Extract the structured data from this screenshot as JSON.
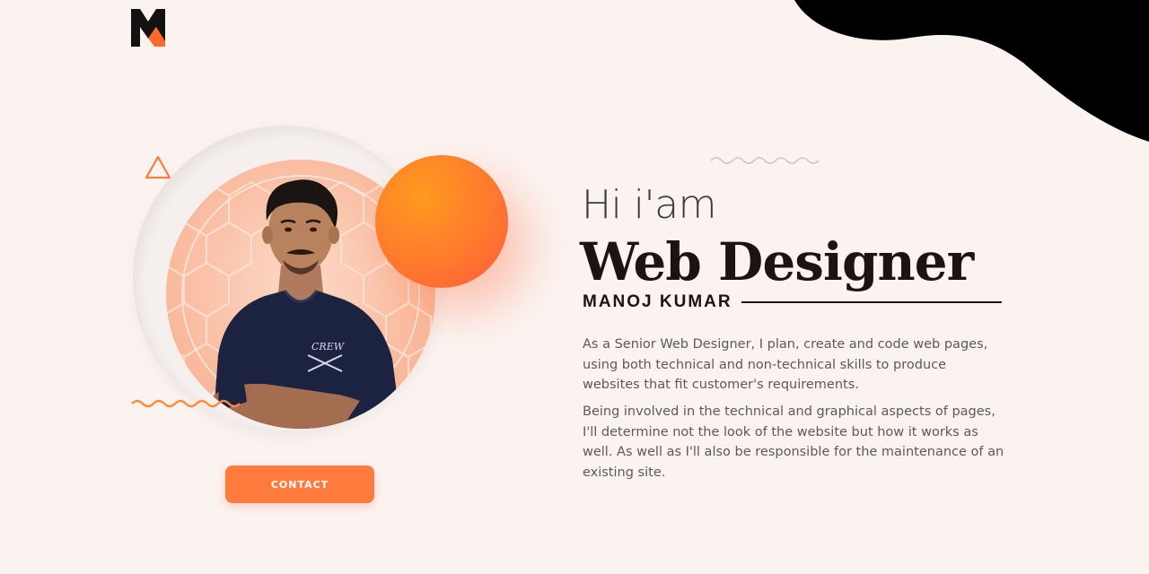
{
  "brand": {
    "logo_icon": "m-monogram-logo-icon",
    "colors": {
      "accent": "#ff7a3d",
      "dark": "#1c140e",
      "background": "#fbf3f0"
    }
  },
  "hero": {
    "greeting": "Hi i'am",
    "role": "Web Designer",
    "name": "MANOJ KUMAR",
    "bio": [
      "As a Senior Web Designer, I plan, create and code web pages, using both technical and non-technical skills to produce websites that fit customer's requirements.",
      "Being involved in the technical and graphical aspects of pages, I'll determine not the look of the website but how it works as well. As well as I'll also be responsible for the maintenance of an existing site."
    ]
  },
  "portrait": {
    "tshirt_text": "CREW"
  },
  "actions": {
    "contact_label": "CONTACT"
  }
}
